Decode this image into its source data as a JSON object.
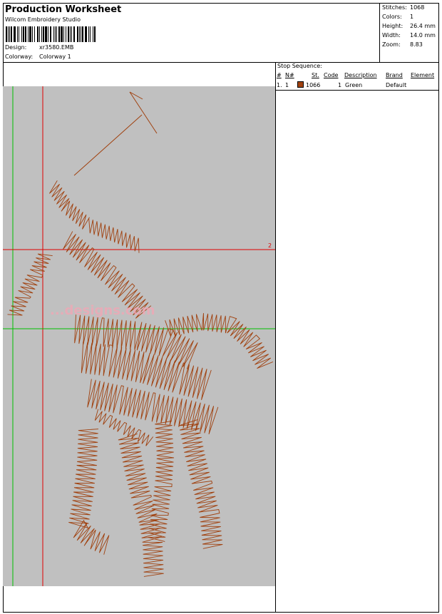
{
  "header": {
    "title": "Production Worksheet",
    "software": "Wilcom Embroidery Studio",
    "design_label": "Design:",
    "design_value": "xr3580.EMB",
    "colorway_label": "Colorway:",
    "colorway_value": "Colorway 1"
  },
  "stats": {
    "stitches_label": "Stitches:",
    "stitches_value": "1068",
    "colors_label": "Colors:",
    "colors_value": "1",
    "height_label": "Height:",
    "height_value": "26.4 mm",
    "width_label": "Width:",
    "width_value": "14.0 mm",
    "zoom_label": "Zoom:",
    "zoom_value": "8.83"
  },
  "stop_sequence": {
    "title": "Stop Sequence:",
    "columns": {
      "num": "#",
      "n": "N#",
      "st": "St.",
      "code": "Code",
      "description": "Description",
      "brand": "Brand",
      "element": "Element"
    },
    "rows": [
      {
        "num": "1.",
        "n": "1",
        "color": "#a0410f",
        "st": "1066",
        "code": "1",
        "description": "Green",
        "brand": "Default",
        "element": ""
      }
    ]
  },
  "canvas": {
    "background": "#c0c0c0",
    "thread_color": "#a0410f",
    "ruler_marker": "2",
    "watermark": "...designs.com"
  }
}
